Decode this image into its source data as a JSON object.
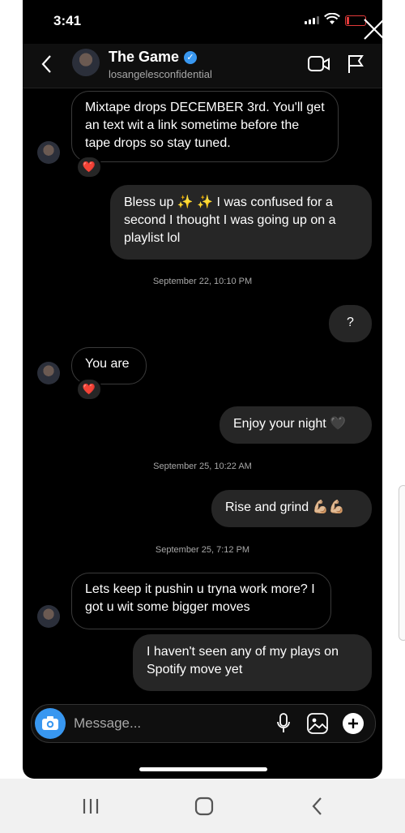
{
  "status": {
    "time": "3:41"
  },
  "header": {
    "name": "The Game",
    "handle": "losangelesconfidential"
  },
  "messages": [
    {
      "from": "them",
      "text": "Mixtape drops DECEMBER 3rd. You'll get an text wit a link sometime before the tape drops so stay tuned.",
      "reaction": "❤️"
    },
    {
      "from": "me",
      "text": "Bless up ✨ ✨  I was confused for a second I thought I was going up on a playlist lol"
    },
    {
      "timestamp": "September 22, 10:10 PM"
    },
    {
      "from": "me",
      "text": "?"
    },
    {
      "from": "them",
      "text": "You are",
      "reaction": "❤️"
    },
    {
      "from": "me",
      "text": "Enjoy your night 🖤"
    },
    {
      "timestamp": "September 25, 10:22 AM"
    },
    {
      "from": "me",
      "text": "Rise and grind 💪🏼💪🏼"
    },
    {
      "timestamp": "September 25, 7:12 PM"
    },
    {
      "from": "them",
      "text": "Lets keep it pushin u tryna work more? I got u wit some bigger moves"
    },
    {
      "from": "me",
      "text": "I haven't seen any of my plays on Spotify move yet"
    }
  ],
  "composer": {
    "placeholder": "Message..."
  },
  "icons": {
    "close": "close-x-icon",
    "back": "chevron-left-icon",
    "verified": "verified-badge-icon",
    "video": "video-call-icon",
    "flag": "report-flag-icon",
    "camera": "camera-icon",
    "mic": "microphone-icon",
    "gallery": "gallery-icon",
    "add": "plus-icon"
  },
  "colors": {
    "accent": "#3897f0",
    "bubble_out": "#262626",
    "background": "#000000",
    "battery_low": "#e23a3a"
  }
}
